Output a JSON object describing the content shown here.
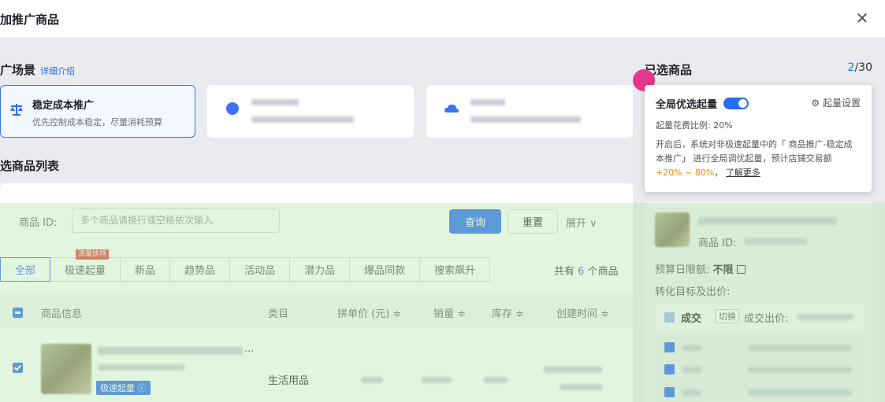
{
  "header": {
    "title": "加推广商品",
    "close_icon": "close-icon"
  },
  "scene": {
    "title": "广场景",
    "link": "详细介绍",
    "options": [
      {
        "title": "稳定成本推广",
        "desc": "优先控制成本稳定，尽量消耗预算"
      }
    ]
  },
  "list": {
    "title": "选商品列表",
    "filter_label": "商品 ID:",
    "search_placeholder": "多个商品请换行或空格依次输入",
    "query_label": "查询",
    "reset_label": "重置",
    "expand_label": "展开 ∨",
    "tabs": [
      "全部",
      "极速起量",
      "新品",
      "趋势品",
      "活动品",
      "潜力品",
      "爆品同款",
      "搜索飙升"
    ],
    "hot_badge": "流量扶持",
    "count_prefix": "共有",
    "count_value": "6",
    "count_suffix": "个商品",
    "columns": [
      "商品信息",
      "类目",
      "拼单价 (元) ≑",
      "销量 ≑",
      "库存 ≑",
      "创建时间 ≑"
    ],
    "row": {
      "category": "生活用品",
      "fast_badge": "极速起量 ⓘ",
      "title_suffix": "..."
    }
  },
  "selected": {
    "title": "已选商品",
    "count_current": "2",
    "count_total": "/30",
    "product_id_label": "商品 ID:",
    "budget_label": "预算日限额:",
    "budget_value": "不限",
    "target_label": "转化目标及出价:",
    "deal_label": "成交",
    "switch_label": "切换",
    "deal_bid_label": "成交出价:"
  },
  "popover": {
    "title": "全局优选起量",
    "settings_label": "起量设置",
    "ratio": "起量花费比例: 20%",
    "desc": "开启后，系统对非极速起量中的「 商品推广-稳定成本推广」 进行全局调优起量，预计店铺交易额",
    "range": "+20% ~ 80%",
    "sep": "，",
    "more": "了解更多"
  },
  "colors": {
    "accent": "#2a6bf2",
    "hot": "#e8453c",
    "orange": "#f08a00",
    "pink": "#e8368f"
  }
}
